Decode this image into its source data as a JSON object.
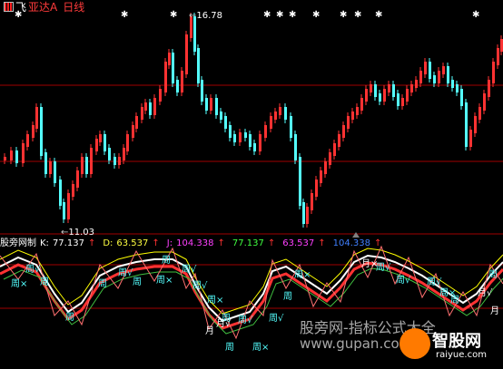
{
  "header": {
    "code_prefix": "飞",
    "stock_name": "亚达A",
    "period": "日线"
  },
  "price_annotations": {
    "high": "16.78",
    "low": "11.03"
  },
  "indicator": {
    "name": "股旁网制",
    "k_label": "K:",
    "k_value": "77.137",
    "d_label": "D:",
    "d_value": "63.537",
    "j_label": "J:",
    "j_value": "104.338",
    "extra1": "77.137",
    "extra2": "63.537",
    "extra3": "104.338",
    "up_arrow": "↑"
  },
  "signal_labels": {
    "week": "周",
    "week_check": "周√",
    "week_cross": "周×",
    "month": "月",
    "month_check": "月√",
    "month_cross": "月×"
  },
  "top_markers": "✱",
  "watermark": {
    "line1": "股旁网-指标公式大全",
    "line2": "www.gupan.com",
    "logo": "智股网",
    "logo_sub": "raiyue.com"
  },
  "colors": {
    "up": "#ff3232",
    "down": "#54ffff",
    "k_line": "#ffffff",
    "d_line": "#ffff00",
    "j_line": "#ff00ff",
    "guide": "#a00000"
  }
}
